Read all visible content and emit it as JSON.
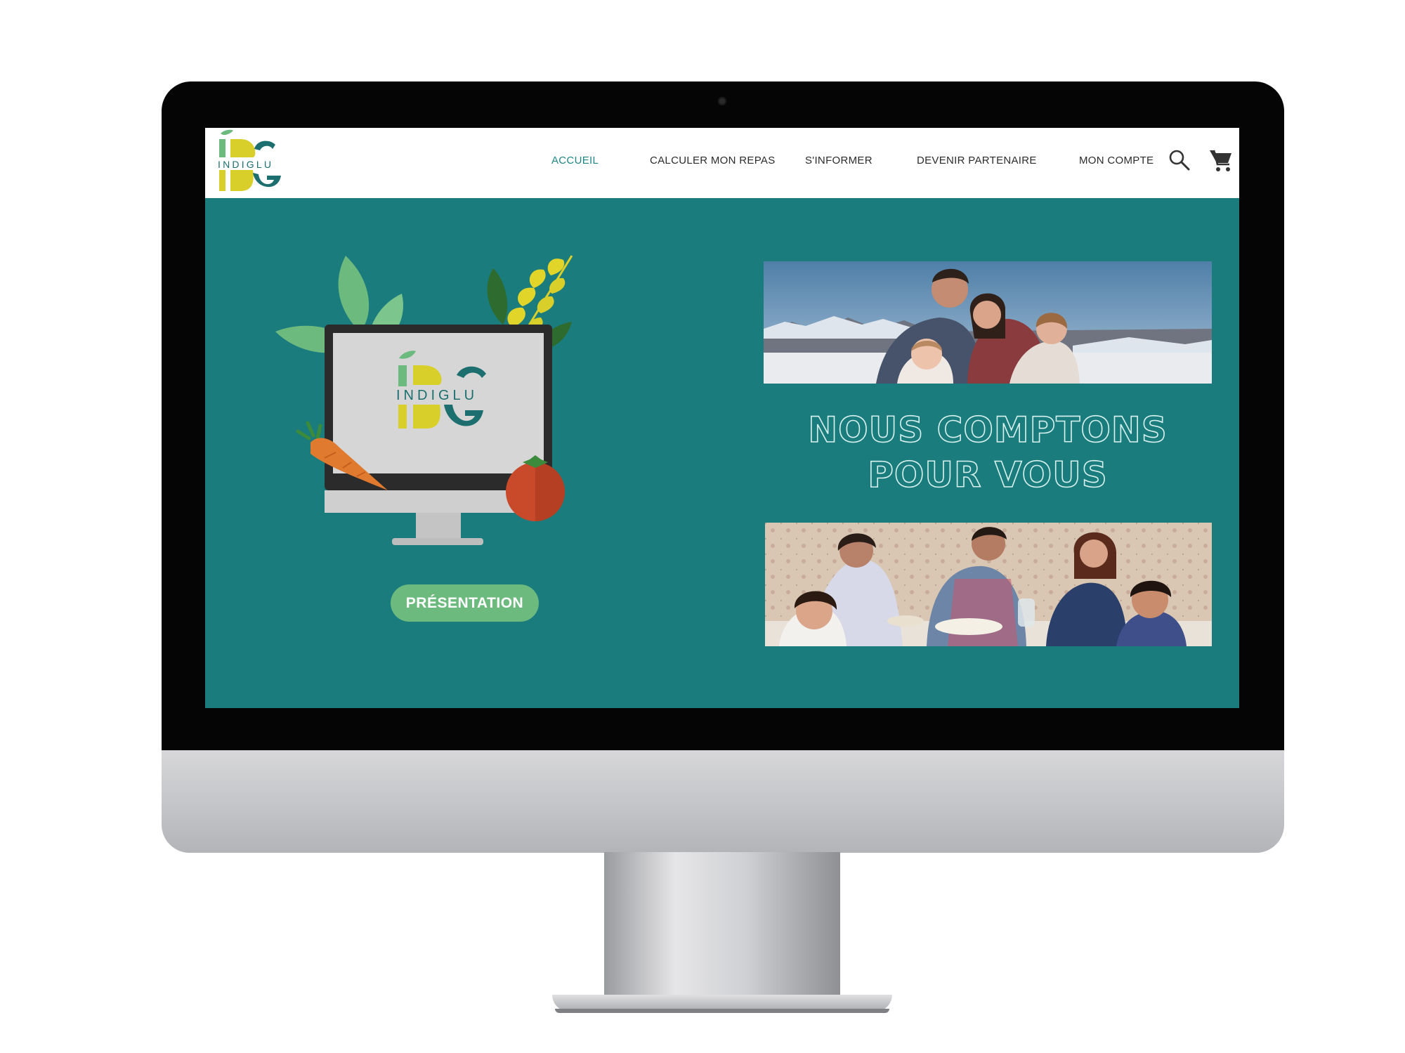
{
  "brand": {
    "logo_text": "INDIGLU",
    "logo_monogram": "IDG",
    "colors": {
      "teal": "#1a7c7c",
      "green": "#6dba7f",
      "yellow": "#d8cf2a",
      "logo_teal": "#1d6f6f"
    }
  },
  "nav": {
    "items": [
      {
        "label": "ACCUEIL",
        "active": true
      },
      {
        "label": "CALCULER MON REPAS",
        "active": false
      },
      {
        "label": "S'INFORMER",
        "active": false
      },
      {
        "label": "DEVENIR PARTENAIRE",
        "active": false
      },
      {
        "label": "MON COMPTE",
        "active": false
      }
    ],
    "icons": [
      "search-icon",
      "cart-icon"
    ]
  },
  "hero": {
    "button_label": "PRÉSENTATION",
    "headline_line1": "NOUS COMPTONS",
    "headline_line2": "POUR VOUS"
  }
}
